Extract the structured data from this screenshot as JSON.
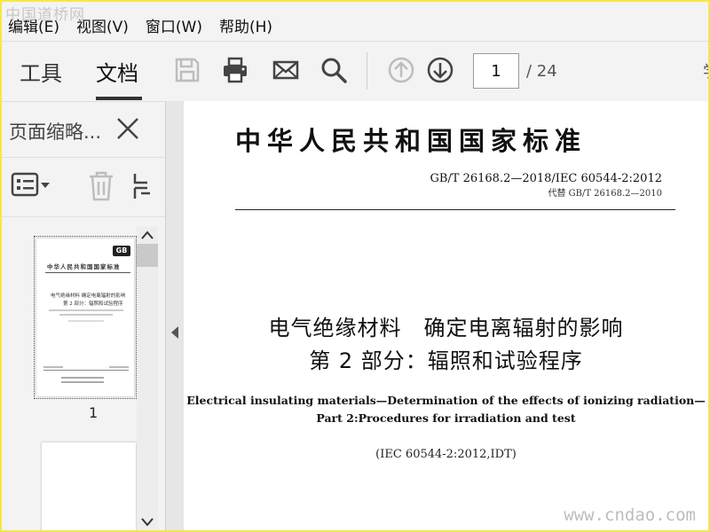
{
  "watermarks": {
    "top": "中国道桥网",
    "bottom": "www.cndao.com"
  },
  "menu": [
    "编辑(E)",
    "视图(V)",
    "窗口(W)",
    "帮助(H)"
  ],
  "toolbar": {
    "tabs": {
      "tools": "工具",
      "document": "文档"
    },
    "page_current": "1",
    "page_total": "/ 24",
    "edge_glyph": "学"
  },
  "left_panel": {
    "title": "页面缩略...",
    "thumbnail_page_number": "1"
  },
  "document": {
    "standard_title": "中华人民共和国国家标准",
    "standard_number": "GB/T 26168.2—2018/IEC 60544-2:2012",
    "replaces": "代替 GB/T 26168.2—2010",
    "cn_title_line1": "电气绝缘材料　确定电离辐射的影响",
    "cn_title_line2": "第 2 部分：辐照和试验程序",
    "en_title_line1": "Electrical insulating materials—Determination of the effects of ionizing radiation—",
    "en_title_line2": "Part 2:Procedures for irradiation and test",
    "iec_equivalence": "(IEC 60544-2:2012,IDT)"
  },
  "thumbnail": {
    "logo": "GB",
    "title": "中华人民共和国国家标准",
    "cn_title": "电气绝缘材料  确定电离辐射的影响",
    "part": "第 2 部分：辐照和试验程序"
  },
  "colors": {
    "frame": "#f5e74a",
    "toolbar_bg": "#f3f3f3",
    "icon": "#444444",
    "icon_disabled": "#bdbdbd"
  }
}
